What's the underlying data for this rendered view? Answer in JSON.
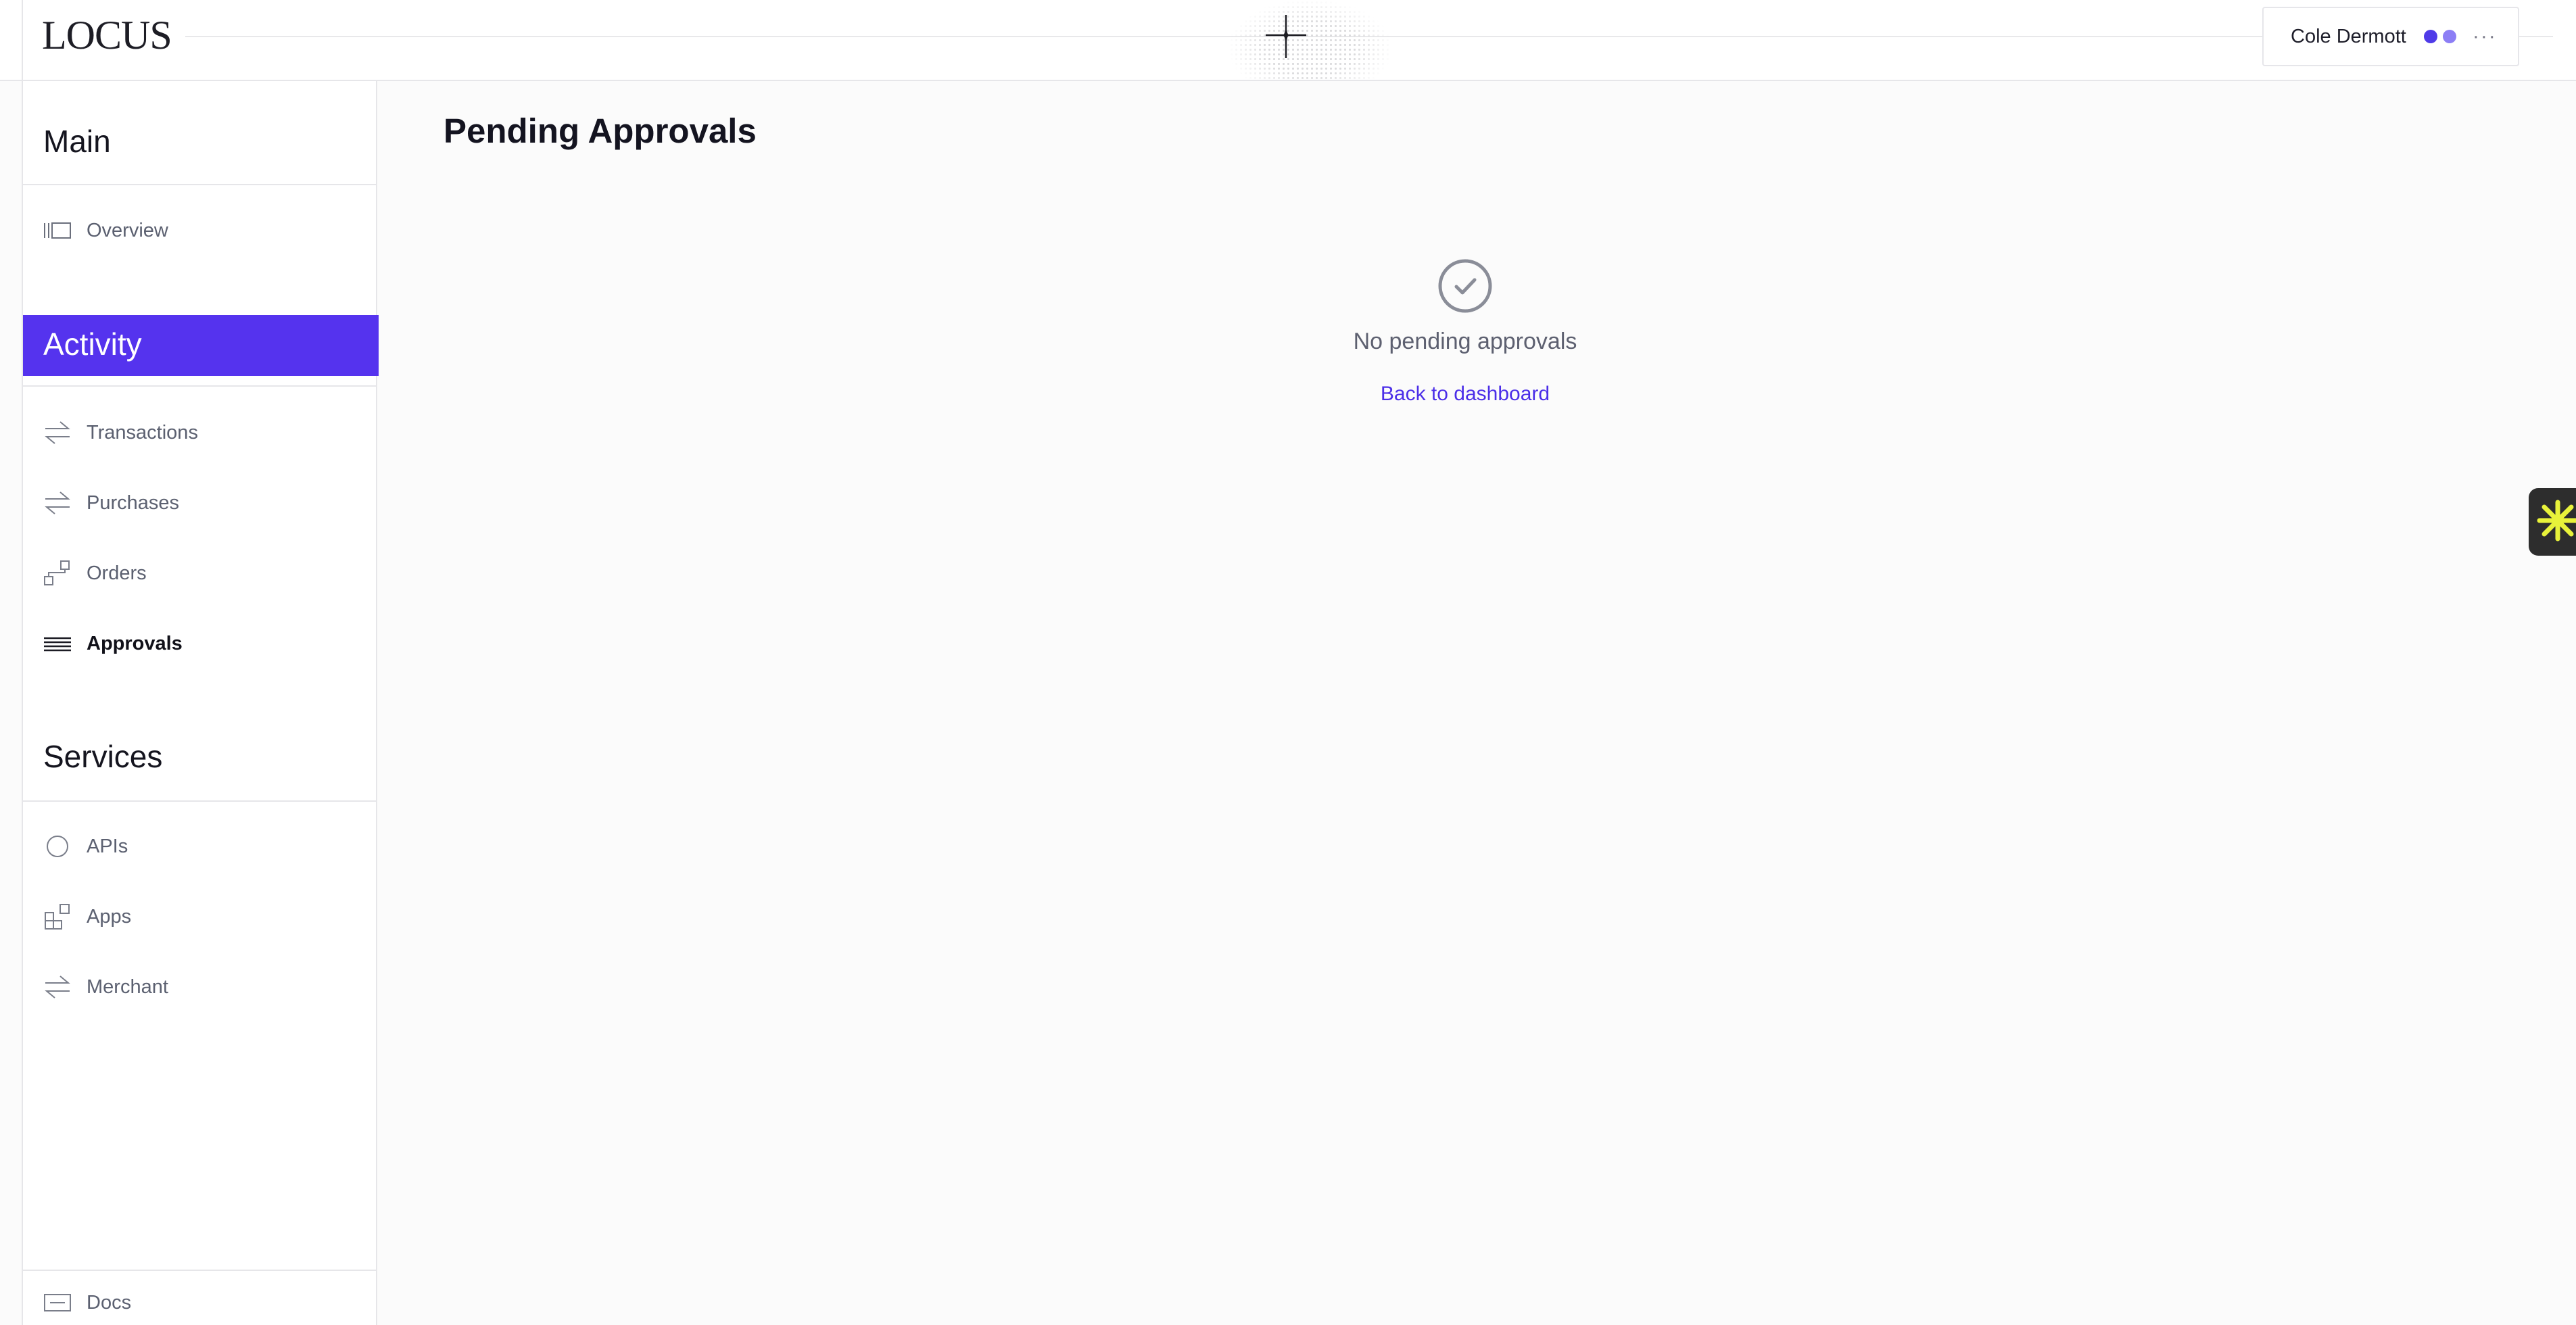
{
  "header": {
    "logo": "LOCUS",
    "user": {
      "name": "Cole Dermott",
      "more_label": "···",
      "status_colors": [
        "#4f3be8",
        "#8c7ef5"
      ]
    }
  },
  "sidebar": {
    "sections": {
      "main": {
        "title": "Main",
        "items": [
          {
            "label": "Overview",
            "icon": "overview-icon"
          }
        ]
      },
      "activity": {
        "title": "Activity",
        "items": [
          {
            "label": "Transactions",
            "icon": "arrows-exchange-icon"
          },
          {
            "label": "Purchases",
            "icon": "arrows-exchange-icon"
          },
          {
            "label": "Orders",
            "icon": "orders-icon"
          },
          {
            "label": "Approvals",
            "icon": "list-icon",
            "active": true
          }
        ]
      },
      "services": {
        "title": "Services",
        "items": [
          {
            "label": "APIs",
            "icon": "circle-icon"
          },
          {
            "label": "Apps",
            "icon": "apps-grid-icon"
          },
          {
            "label": "Merchant",
            "icon": "arrows-exchange-icon"
          }
        ]
      }
    },
    "footer": {
      "label": "Docs",
      "icon": "docs-icon"
    }
  },
  "main": {
    "title": "Pending Approvals",
    "empty_state": {
      "message": "No pending approvals",
      "link": "Back to dashboard",
      "icon": "check-circle-icon"
    }
  },
  "widget": {
    "icon": "asterisk-icon"
  },
  "colors": {
    "accent": "#5533ee",
    "link": "#4b2ee8",
    "widget_icon": "#e8f23a"
  }
}
